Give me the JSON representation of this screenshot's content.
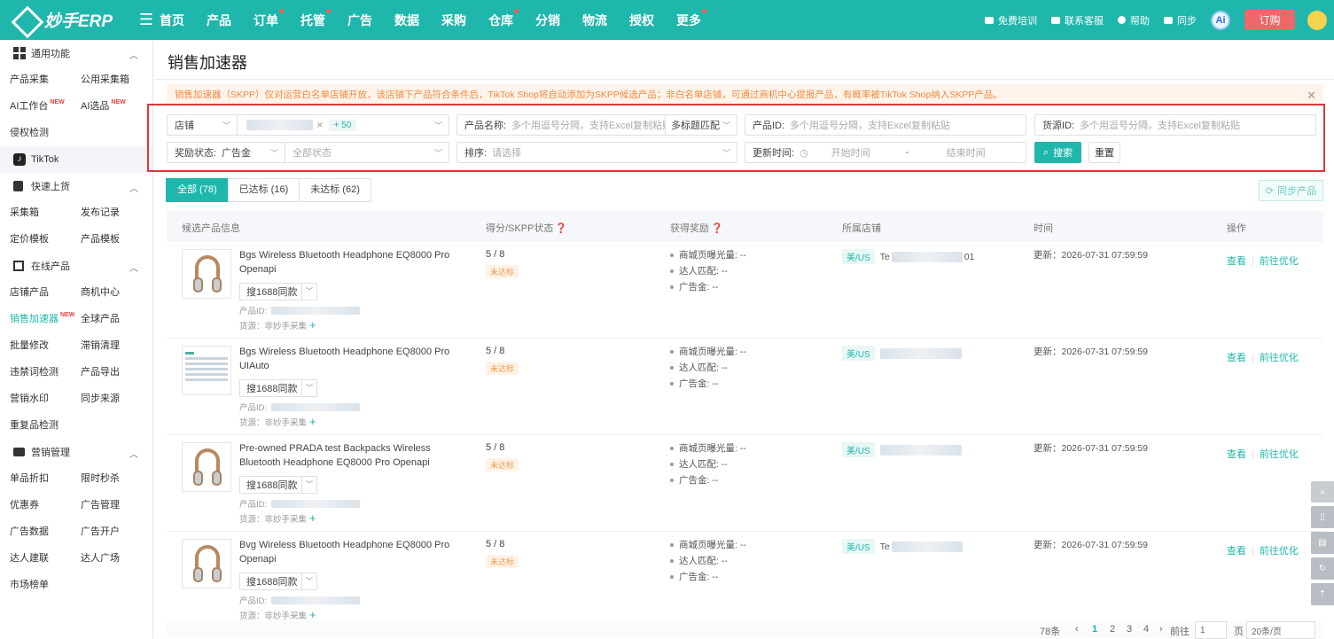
{
  "header": {
    "logo": "妙手ERP",
    "menu_icon": "menu-icon",
    "nav": [
      {
        "label": "首页",
        "dot": false
      },
      {
        "label": "产品",
        "dot": false
      },
      {
        "label": "订单",
        "dot": true
      },
      {
        "label": "托管",
        "dot": true
      },
      {
        "label": "广告",
        "dot": false
      },
      {
        "label": "数据",
        "dot": false
      },
      {
        "label": "采购",
        "dot": false
      },
      {
        "label": "仓库",
        "dot": true
      },
      {
        "label": "分销",
        "dot": false
      },
      {
        "label": "物流",
        "dot": false
      },
      {
        "label": "授权",
        "dot": false
      },
      {
        "label": "更多",
        "dot": true
      }
    ],
    "links": {
      "training": "免费培训",
      "support": "联系客服",
      "help": "帮助",
      "sync": "同步"
    },
    "ai_badge": "Ai",
    "order": "订购"
  },
  "sidebar": {
    "general": {
      "title": "通用功能",
      "items": [
        "产品采集",
        "公用采集箱",
        "AI工作台",
        "AI选品",
        "侵权检测"
      ],
      "new_badge": "NEW"
    },
    "tiktok": "TikTok",
    "quick": {
      "title": "快速上货",
      "items": [
        "采集箱",
        "发布记录",
        "定价模板",
        "产品模板"
      ]
    },
    "online": {
      "title": "在线产品",
      "items": [
        "店铺产品",
        "商机中心",
        "销售加速器",
        "全球产品",
        "批量修改",
        "滞销清理",
        "违禁词检测",
        "产品导出",
        "营销水印",
        "同步来源",
        "重复品检测"
      ]
    },
    "marketing": {
      "title": "营销管理",
      "items": [
        "单品折扣",
        "限时秒杀",
        "优惠券",
        "广告管理",
        "广告数据",
        "广告开户",
        "达人建联",
        "达人广场",
        "市场榜单"
      ]
    }
  },
  "page": {
    "title": "销售加速器",
    "notice": "销售加速器（SKPP）仅对运营白名单店铺开放，该店铺下产品符合条件后，TikTok Shop将自动添加为SKPP候选产品；非白名单店铺，可通过商机中心提报产品，有概率被TikTok Shop纳入SKPP产品。",
    "filters": {
      "shop_label": "店铺",
      "shop_more": "+ 50",
      "name_label": "产品名称:",
      "name_ph": "多个用逗号分隔，支持Excel复制粘贴",
      "match_mode": "多标题匹配",
      "pid_label": "产品ID:",
      "pid_ph": "多个用逗号分隔，支持Excel复制粘贴",
      "src_label": "货源ID:",
      "src_ph": "多个用逗号分隔，支持Excel复制粘贴",
      "reward_label": "奖励状态:",
      "reward_value": "广告金",
      "status_ph": "全部状态",
      "sort_label": "排序:",
      "sort_ph": "请选择",
      "time_label": "更新时间:",
      "start_ph": "开始时间",
      "dash": "-",
      "end_ph": "结束时间",
      "search": "搜索",
      "reset": "重置"
    },
    "tabs": [
      "全部 (78)",
      "已达标 (16)",
      "未达标 (62)"
    ],
    "sync_btn": "同步产品",
    "columns": {
      "info": "候选产品信息",
      "score": "得分/SKPP状态",
      "reward": "获得奖励",
      "shop": "所属店铺",
      "time": "时间",
      "ops": "操作"
    }
  },
  "rows": [
    {
      "name": "Bgs Wireless Bluetooth Headphone EQ8000 Pro Openapi",
      "thumb": "headphone",
      "score": "5 / 8",
      "status": "未达标",
      "shop_prefix": "Te",
      "shop_suffix": "01"
    },
    {
      "name": "Bgs Wireless Bluetooth Headphone EQ8000 Pro UIAuto",
      "thumb": "sheet",
      "score": "5 / 8",
      "status": "未达标",
      "shop_prefix": "",
      "shop_suffix": ""
    },
    {
      "name": "Pre-owned PRADA test Backpacks Wireless Bluetooth Headphone EQ8000 Pro Openapi",
      "thumb": "headphone",
      "score": "5 / 8",
      "status": "未达标",
      "shop_prefix": "",
      "shop_suffix": ""
    },
    {
      "name": "Bvg Wireless Bluetooth Headphone EQ8000 Pro Openapi",
      "thumb": "headphone",
      "score": "5 / 8",
      "status": "未达标",
      "shop_prefix": "Te",
      "shop_suffix": ""
    }
  ],
  "row_common": {
    "search1688": "搜1688同款",
    "pid_label": "产品ID:",
    "source": "货源：非妙手采集",
    "plus": "+",
    "exposure": "商城页曝光量:",
    "exposure_val": "--",
    "creator": "达人匹配:",
    "creator_val": "--",
    "ad_fund": "广告金:",
    "ad_fund_val": "--",
    "region": "美/US",
    "time": "更新：2026-07-31 07:59:59",
    "view": "查看",
    "optimize": "前往优化",
    "sep": "|"
  },
  "pager": {
    "total": "78条",
    "p1": "1",
    "p2": "2",
    "p3": "3",
    "p4": "4",
    "goto": "前往",
    "page_input": "1",
    "page_unit": "页",
    "size": "20条/页"
  },
  "colors": {
    "accent": "#1fb7ac",
    "danger": "#e03636",
    "notice": "#f28a3d"
  }
}
